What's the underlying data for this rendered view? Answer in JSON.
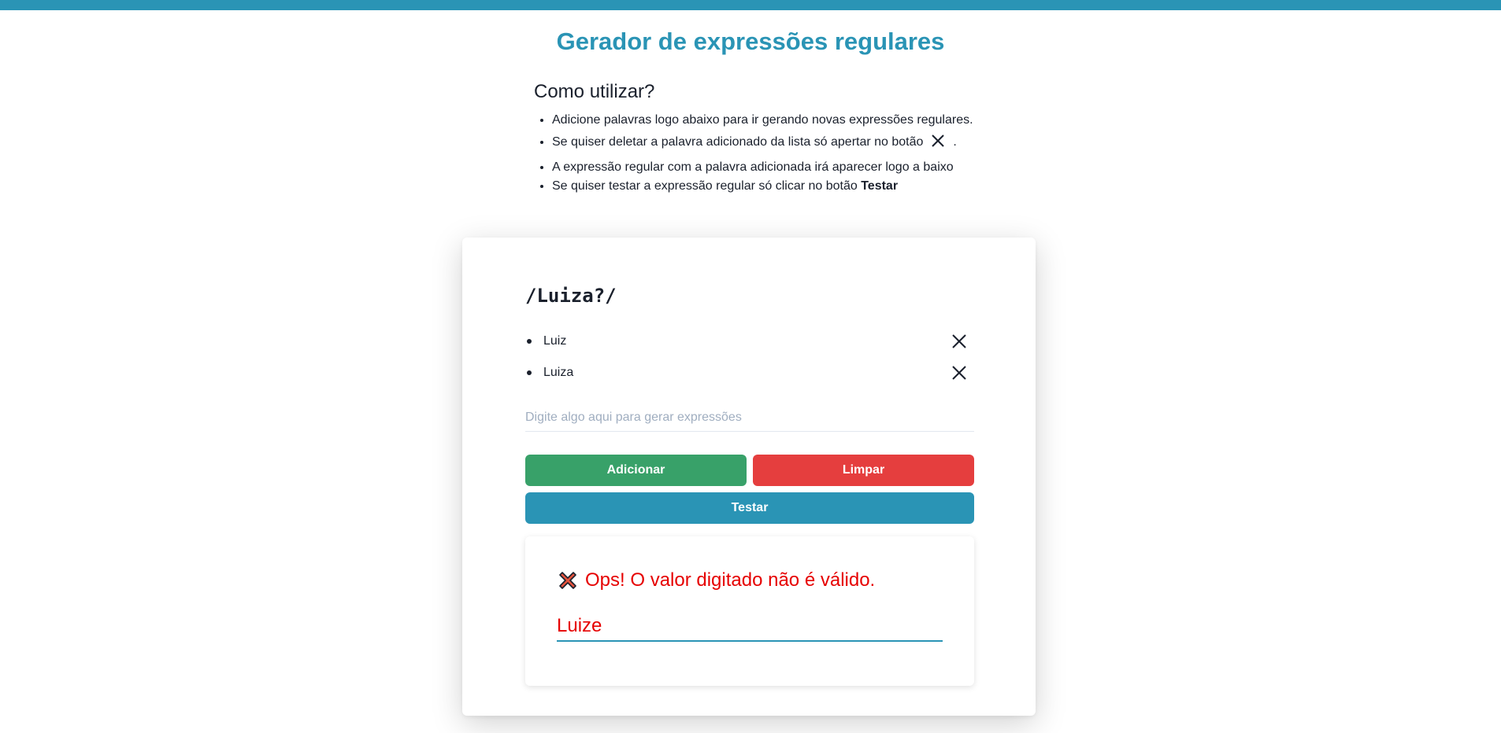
{
  "title": "Gerador de expressões regulares",
  "how_to": {
    "heading": "Como utilizar?",
    "step1": "Adicione palavras logo abaixo para ir gerando novas expressões regulares.",
    "step2_before": "Se quiser deletar a palavra adicionado da lista só apertar no botão",
    "step2_after": ".",
    "step3": "A expressão regular com a palavra adicionada irá aparecer logo a baixo",
    "step4_before": "Se quiser testar a expressão regular só clicar no botão",
    "step4_bold": "Testar"
  },
  "generator": {
    "regex": "/Luiza?/",
    "words": [
      "Luiz",
      "Luiza"
    ],
    "input_placeholder": "Digite algo aqui para gerar expressões",
    "input_value": ""
  },
  "buttons": {
    "add": "Adicionar",
    "clear": "Limpar",
    "test": "Testar"
  },
  "test_result": {
    "icon": "cross-mark-icon",
    "message": "Ops! O valor digitado não é válido.",
    "tested_value": "Luize",
    "color": "#e60000"
  },
  "colors": {
    "accent": "#2a94b5",
    "add": "#38a169",
    "clear": "#e53e3e"
  }
}
